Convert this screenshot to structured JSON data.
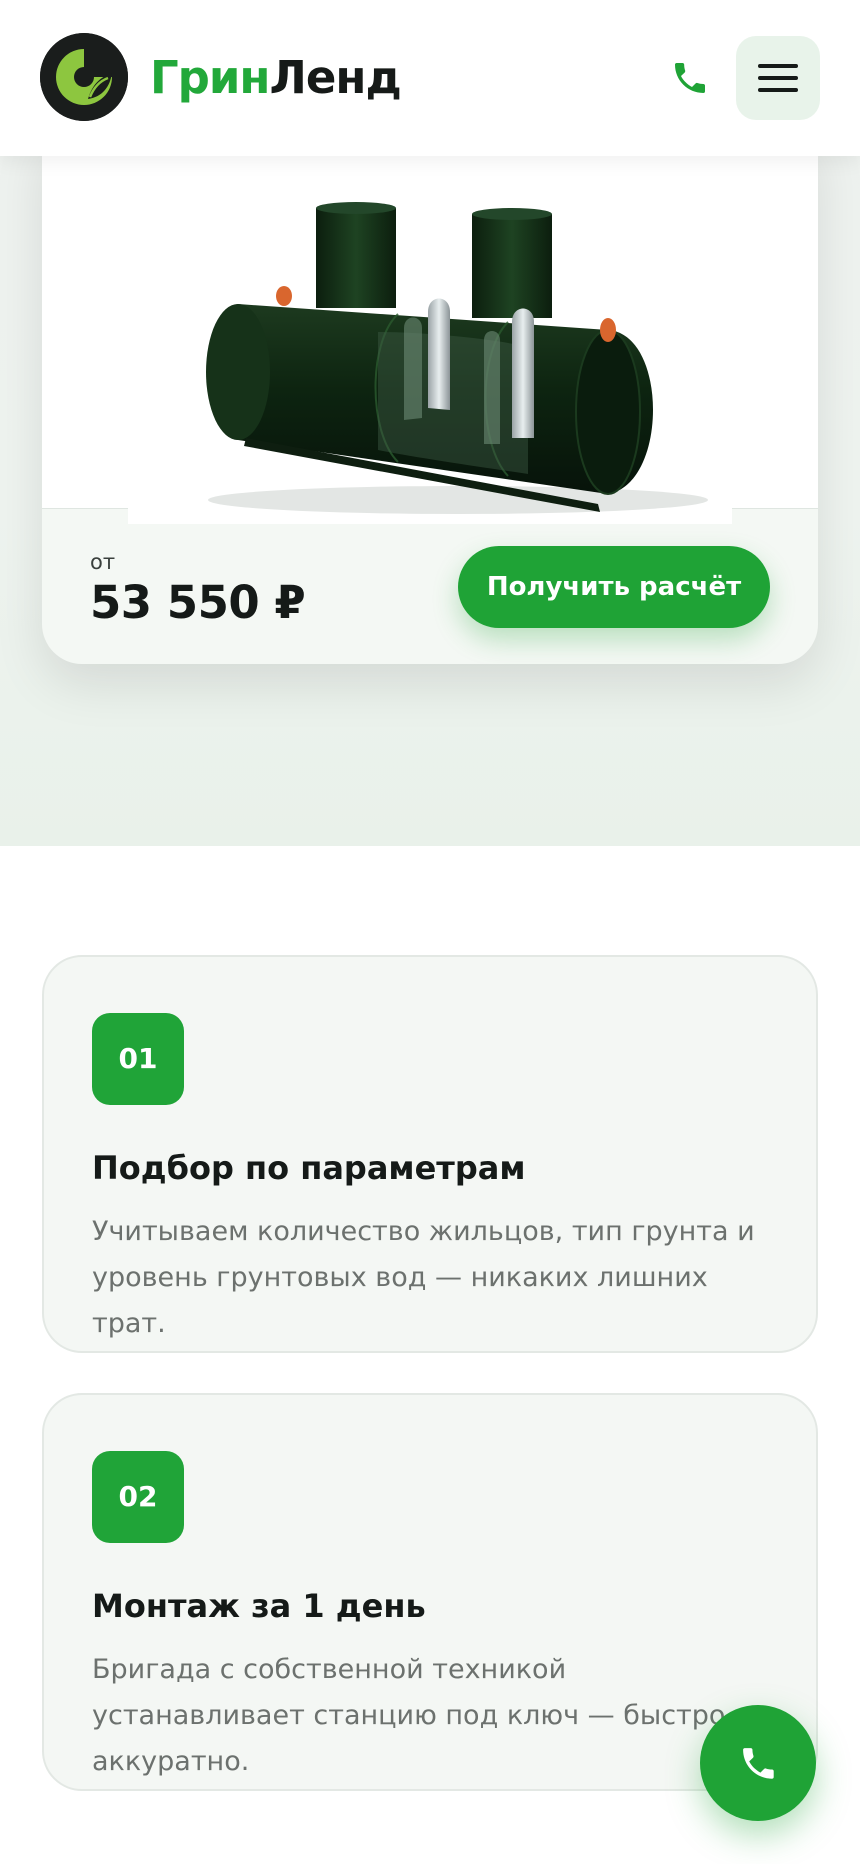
{
  "brand": {
    "name_part1": "Грин",
    "name_part2": "Ленд",
    "logo_letter": "G",
    "accent_color": "#1fa336",
    "dark_color": "#151a18"
  },
  "header": {
    "phone_icon": "phone-icon",
    "menu_icon": "hamburger-menu-icon"
  },
  "product": {
    "image_icon": "septic-tank-image",
    "price_prefix": "от",
    "price": "53 550 ₽",
    "cta_label": "Получить расчёт"
  },
  "features": [
    {
      "number": "01",
      "title": "Подбор по параметрам",
      "description": "Учитываем количество жильцов, тип грунта и уровень грунтовых вод — никаких лишних трат."
    },
    {
      "number": "02",
      "title": "Монтаж за 1 день",
      "description": "Бригада с собственной техникой устанавливает станцию под ключ — быстро и аккуратно."
    }
  ],
  "fab": {
    "icon": "phone-icon"
  }
}
